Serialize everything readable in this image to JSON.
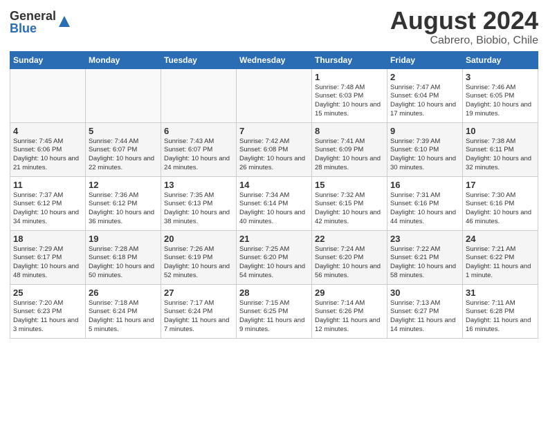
{
  "header": {
    "logo_general": "General",
    "logo_blue": "Blue",
    "title": "August 2024",
    "location": "Cabrero, Biobio, Chile"
  },
  "weekdays": [
    "Sunday",
    "Monday",
    "Tuesday",
    "Wednesday",
    "Thursday",
    "Friday",
    "Saturday"
  ],
  "weeks": [
    [
      {
        "day": "",
        "content": ""
      },
      {
        "day": "",
        "content": ""
      },
      {
        "day": "",
        "content": ""
      },
      {
        "day": "",
        "content": ""
      },
      {
        "day": "1",
        "content": "Sunrise: 7:48 AM\nSunset: 6:03 PM\nDaylight: 10 hours and 15 minutes."
      },
      {
        "day": "2",
        "content": "Sunrise: 7:47 AM\nSunset: 6:04 PM\nDaylight: 10 hours and 17 minutes."
      },
      {
        "day": "3",
        "content": "Sunrise: 7:46 AM\nSunset: 6:05 PM\nDaylight: 10 hours and 19 minutes."
      }
    ],
    [
      {
        "day": "4",
        "content": "Sunrise: 7:45 AM\nSunset: 6:06 PM\nDaylight: 10 hours and 21 minutes."
      },
      {
        "day": "5",
        "content": "Sunrise: 7:44 AM\nSunset: 6:07 PM\nDaylight: 10 hours and 22 minutes."
      },
      {
        "day": "6",
        "content": "Sunrise: 7:43 AM\nSunset: 6:07 PM\nDaylight: 10 hours and 24 minutes."
      },
      {
        "day": "7",
        "content": "Sunrise: 7:42 AM\nSunset: 6:08 PM\nDaylight: 10 hours and 26 minutes."
      },
      {
        "day": "8",
        "content": "Sunrise: 7:41 AM\nSunset: 6:09 PM\nDaylight: 10 hours and 28 minutes."
      },
      {
        "day": "9",
        "content": "Sunrise: 7:39 AM\nSunset: 6:10 PM\nDaylight: 10 hours and 30 minutes."
      },
      {
        "day": "10",
        "content": "Sunrise: 7:38 AM\nSunset: 6:11 PM\nDaylight: 10 hours and 32 minutes."
      }
    ],
    [
      {
        "day": "11",
        "content": "Sunrise: 7:37 AM\nSunset: 6:12 PM\nDaylight: 10 hours and 34 minutes."
      },
      {
        "day": "12",
        "content": "Sunrise: 7:36 AM\nSunset: 6:12 PM\nDaylight: 10 hours and 36 minutes."
      },
      {
        "day": "13",
        "content": "Sunrise: 7:35 AM\nSunset: 6:13 PM\nDaylight: 10 hours and 38 minutes."
      },
      {
        "day": "14",
        "content": "Sunrise: 7:34 AM\nSunset: 6:14 PM\nDaylight: 10 hours and 40 minutes."
      },
      {
        "day": "15",
        "content": "Sunrise: 7:32 AM\nSunset: 6:15 PM\nDaylight: 10 hours and 42 minutes."
      },
      {
        "day": "16",
        "content": "Sunrise: 7:31 AM\nSunset: 6:16 PM\nDaylight: 10 hours and 44 minutes."
      },
      {
        "day": "17",
        "content": "Sunrise: 7:30 AM\nSunset: 6:16 PM\nDaylight: 10 hours and 46 minutes."
      }
    ],
    [
      {
        "day": "18",
        "content": "Sunrise: 7:29 AM\nSunset: 6:17 PM\nDaylight: 10 hours and 48 minutes."
      },
      {
        "day": "19",
        "content": "Sunrise: 7:28 AM\nSunset: 6:18 PM\nDaylight: 10 hours and 50 minutes."
      },
      {
        "day": "20",
        "content": "Sunrise: 7:26 AM\nSunset: 6:19 PM\nDaylight: 10 hours and 52 minutes."
      },
      {
        "day": "21",
        "content": "Sunrise: 7:25 AM\nSunset: 6:20 PM\nDaylight: 10 hours and 54 minutes."
      },
      {
        "day": "22",
        "content": "Sunrise: 7:24 AM\nSunset: 6:20 PM\nDaylight: 10 hours and 56 minutes."
      },
      {
        "day": "23",
        "content": "Sunrise: 7:22 AM\nSunset: 6:21 PM\nDaylight: 10 hours and 58 minutes."
      },
      {
        "day": "24",
        "content": "Sunrise: 7:21 AM\nSunset: 6:22 PM\nDaylight: 11 hours and 1 minute."
      }
    ],
    [
      {
        "day": "25",
        "content": "Sunrise: 7:20 AM\nSunset: 6:23 PM\nDaylight: 11 hours and 3 minutes."
      },
      {
        "day": "26",
        "content": "Sunrise: 7:18 AM\nSunset: 6:24 PM\nDaylight: 11 hours and 5 minutes."
      },
      {
        "day": "27",
        "content": "Sunrise: 7:17 AM\nSunset: 6:24 PM\nDaylight: 11 hours and 7 minutes."
      },
      {
        "day": "28",
        "content": "Sunrise: 7:15 AM\nSunset: 6:25 PM\nDaylight: 11 hours and 9 minutes."
      },
      {
        "day": "29",
        "content": "Sunrise: 7:14 AM\nSunset: 6:26 PM\nDaylight: 11 hours and 12 minutes."
      },
      {
        "day": "30",
        "content": "Sunrise: 7:13 AM\nSunset: 6:27 PM\nDaylight: 11 hours and 14 minutes."
      },
      {
        "day": "31",
        "content": "Sunrise: 7:11 AM\nSunset: 6:28 PM\nDaylight: 11 hours and 16 minutes."
      }
    ]
  ]
}
